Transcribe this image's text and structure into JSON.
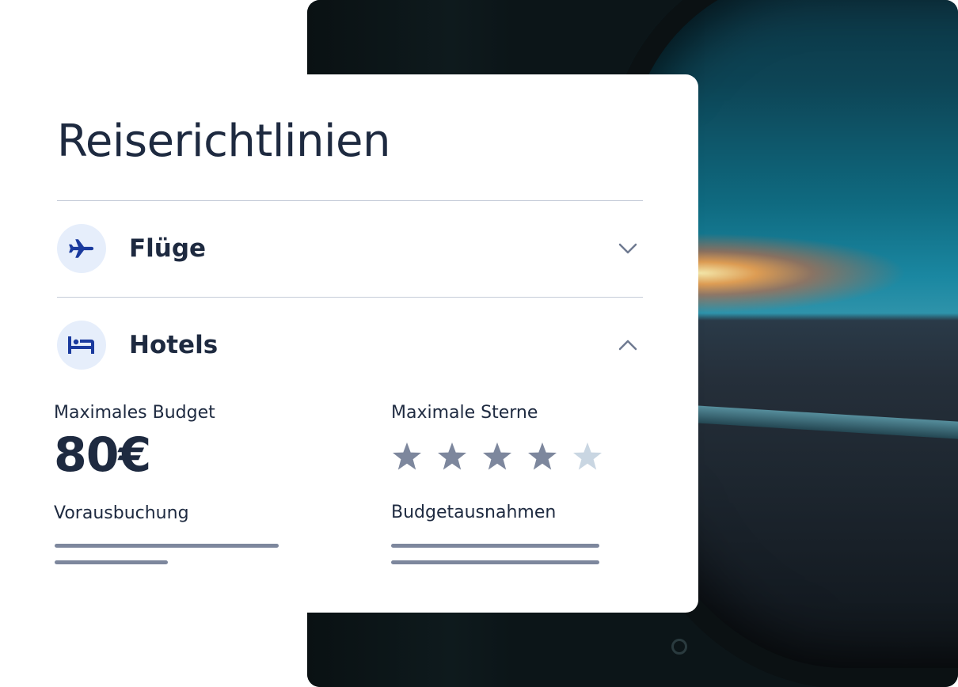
{
  "title": "Reiserichtlinien",
  "sections": [
    {
      "label": "Flüge",
      "icon": "airplane-icon",
      "expanded": false
    },
    {
      "label": "Hotels",
      "icon": "bed-icon",
      "expanded": true
    }
  ],
  "hotels": {
    "max_budget_label": "Maximales Budget",
    "max_budget_value": "80€",
    "max_stars_label": "Maximale Sterne",
    "max_stars_value": 4,
    "stars_total": 5,
    "advance_booking_label": "Vorausbuchung",
    "budget_exceptions_label": "Budgetausnahmen"
  },
  "colors": {
    "text": "#1e2a40",
    "icon_blue": "#1a3a9e",
    "icon_bg": "#e6eefb",
    "star_filled": "#7d879d",
    "star_empty": "#c9d6e2",
    "divider": "#c5ccd8"
  }
}
